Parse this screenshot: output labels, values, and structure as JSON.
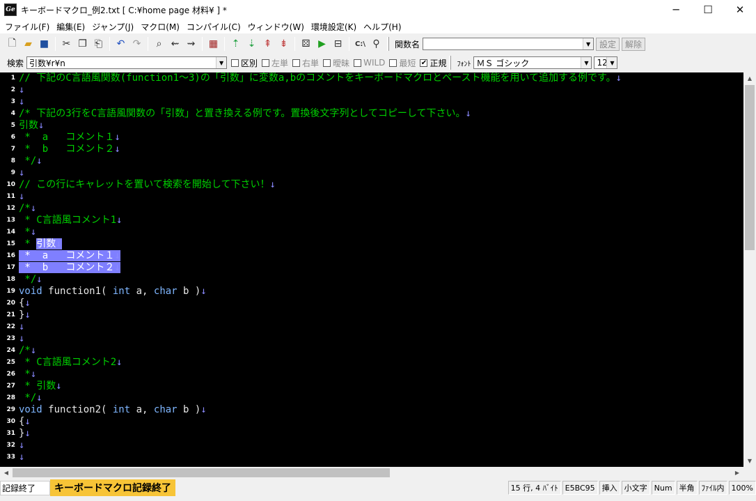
{
  "window": {
    "title": "キーボードマクロ_例2.txt [ C:¥home page 材料¥ ] *",
    "app_icon": "Ge"
  },
  "menu": [
    "ファイル(F)",
    "編集(E)",
    "ジャンプ(J)",
    "マクロ(M)",
    "コンパイル(C)",
    "ウィンドウ(W)",
    "環境設定(K)",
    "ヘルプ(H)"
  ],
  "toolbar1": {
    "func_label": "関数名",
    "func_value": "",
    "set_label": "設定",
    "release_label": "解除"
  },
  "toolbar2": {
    "search_label": "検索",
    "search_value": "引数¥r¥n",
    "options": [
      {
        "label": "区別",
        "checked": false,
        "enabled": true
      },
      {
        "label": "左単",
        "checked": false,
        "enabled": false
      },
      {
        "label": "右単",
        "checked": false,
        "enabled": false
      },
      {
        "label": "曖昧",
        "checked": false,
        "enabled": false
      },
      {
        "label": "WILD",
        "checked": false,
        "enabled": false
      },
      {
        "label": "最短",
        "checked": false,
        "enabled": false
      },
      {
        "label": "正規",
        "checked": true,
        "enabled": true
      }
    ],
    "font_label": "ﾌｫﾝﾄ",
    "font_value": "ＭＳ ゴシック",
    "size_value": "12"
  },
  "editor": {
    "eol_mark": "↓",
    "lines": [
      {
        "n": "1",
        "segs": [
          {
            "t": "// 下記のC言語風関数(function1～3)の「引数」に変数a,bのコメントをキーボードマクロとペースト機能を用いて追加する例です。",
            "c": "c-com"
          }
        ]
      },
      {
        "n": "2",
        "segs": []
      },
      {
        "n": "3",
        "segs": []
      },
      {
        "n": "4",
        "segs": [
          {
            "t": "/* 下記の3行をC言語風関数の「引数」と置き換える例です。置換後文字列としてコピーして下さい。",
            "c": "c-com"
          }
        ]
      },
      {
        "n": "5",
        "segs": [
          {
            "t": "引数",
            "c": "c-com"
          }
        ]
      },
      {
        "n": "6",
        "segs": [
          {
            "t": " *  a   コメント１",
            "c": "c-com"
          }
        ]
      },
      {
        "n": "7",
        "segs": [
          {
            "t": " *  b   コメント２",
            "c": "c-com"
          }
        ]
      },
      {
        "n": "8",
        "segs": [
          {
            "t": " */",
            "c": "c-com"
          }
        ]
      },
      {
        "n": "9",
        "segs": []
      },
      {
        "n": "10",
        "segs": [
          {
            "t": "// この行にキャレットを置いて検索を開始して下さい！",
            "c": "c-com"
          }
        ]
      },
      {
        "n": "11",
        "segs": []
      },
      {
        "n": "12",
        "segs": [
          {
            "t": "/*",
            "c": "c-com"
          }
        ]
      },
      {
        "n": "13",
        "segs": [
          {
            "t": " * C言語風コメント1",
            "c": "c-com"
          }
        ]
      },
      {
        "n": "14",
        "segs": [
          {
            "t": " *",
            "c": "c-com"
          }
        ]
      },
      {
        "n": "15",
        "segs": [
          {
            "t": " * ",
            "c": "c-com"
          },
          {
            "t": "引数",
            "c": "sel"
          }
        ]
      },
      {
        "n": "16",
        "segs": [
          {
            "t": " *  a   コメント１",
            "c": "sel"
          }
        ]
      },
      {
        "n": "17",
        "segs": [
          {
            "t": " *  b   コメント２",
            "c": "sel"
          }
        ]
      },
      {
        "n": "18",
        "segs": [
          {
            "t": " */",
            "c": "c-com"
          }
        ]
      },
      {
        "n": "19",
        "segs": [
          {
            "t": "void",
            "c": "c-kw"
          },
          {
            "t": " function1( ",
            "c": "c-plain"
          },
          {
            "t": "int",
            "c": "c-kw"
          },
          {
            "t": " a, ",
            "c": "c-plain"
          },
          {
            "t": "char",
            "c": "c-kw"
          },
          {
            "t": " b )",
            "c": "c-plain"
          }
        ]
      },
      {
        "n": "20",
        "segs": [
          {
            "t": "{",
            "c": "c-plain"
          }
        ]
      },
      {
        "n": "21",
        "segs": [
          {
            "t": "}",
            "c": "c-plain"
          }
        ]
      },
      {
        "n": "22",
        "segs": []
      },
      {
        "n": "23",
        "segs": []
      },
      {
        "n": "24",
        "segs": [
          {
            "t": "/*",
            "c": "c-com"
          }
        ]
      },
      {
        "n": "25",
        "segs": [
          {
            "t": " * C言語風コメント2",
            "c": "c-com"
          }
        ]
      },
      {
        "n": "26",
        "segs": [
          {
            "t": " *",
            "c": "c-com"
          }
        ]
      },
      {
        "n": "27",
        "segs": [
          {
            "t": " * 引数",
            "c": "c-com"
          }
        ]
      },
      {
        "n": "28",
        "segs": [
          {
            "t": " */",
            "c": "c-com"
          }
        ]
      },
      {
        "n": "29",
        "segs": [
          {
            "t": "void",
            "c": "c-kw"
          },
          {
            "t": " function2( ",
            "c": "c-plain"
          },
          {
            "t": "int",
            "c": "c-kw"
          },
          {
            "t": " a, ",
            "c": "c-plain"
          },
          {
            "t": "char",
            "c": "c-kw"
          },
          {
            "t": " b )",
            "c": "c-plain"
          }
        ]
      },
      {
        "n": "30",
        "segs": [
          {
            "t": "{",
            "c": "c-plain"
          }
        ]
      },
      {
        "n": "31",
        "segs": [
          {
            "t": "}",
            "c": "c-plain"
          }
        ]
      },
      {
        "n": "32",
        "segs": []
      },
      {
        "n": "33",
        "segs": []
      }
    ]
  },
  "status": {
    "left": "記録終了",
    "macro": "キーボードマクロ記録終了",
    "cells": [
      "15 行, 4 ﾊﾞｲﾄ",
      "E5BC95",
      "挿入",
      "小文字",
      "Num",
      "半角",
      "ﾌｧｲﾙ内",
      "100%"
    ]
  }
}
